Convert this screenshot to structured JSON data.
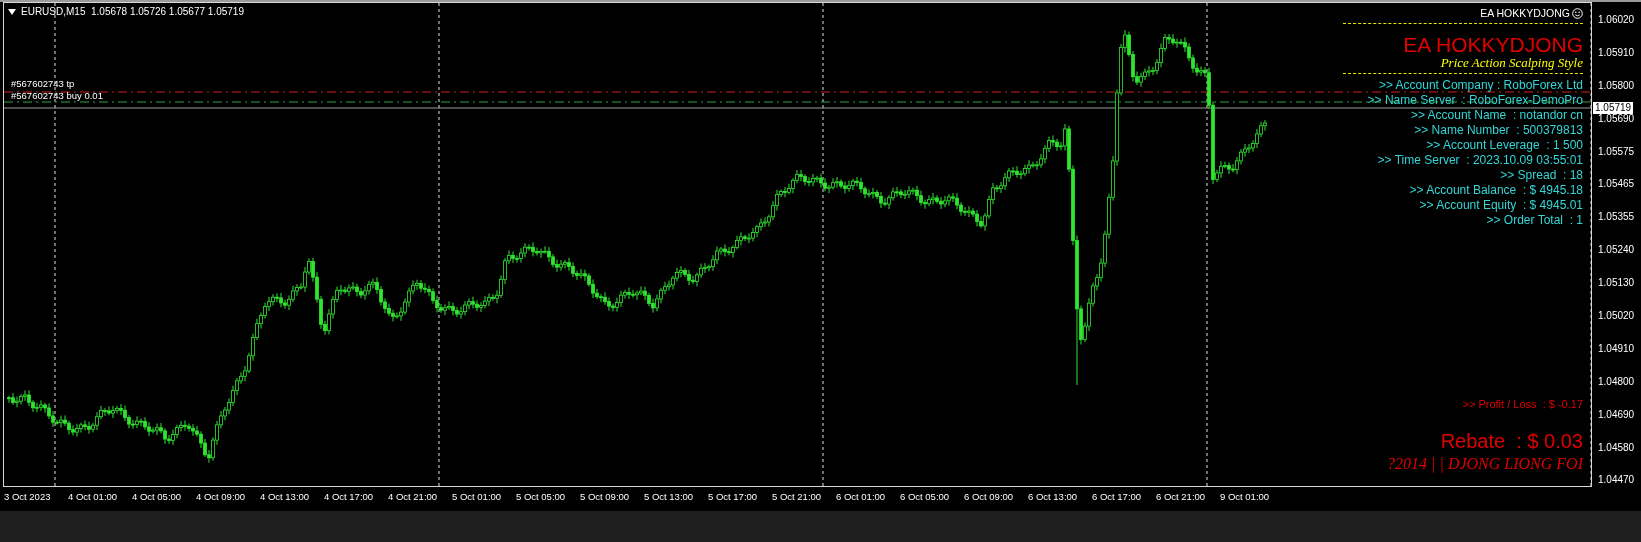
{
  "chart": {
    "symbol_info": "EURUSD,M15  1.05678 1.05726 1.05677 1.05719",
    "order_labels": [
      "#567602743 tp",
      "#567602743 buy 0.01"
    ],
    "current_price": "1.05719",
    "price_axis": [
      "1.06020",
      "1.05910",
      "1.05800",
      "1.05690",
      "1.05575",
      "1.05465",
      "1.05355",
      "1.05240",
      "1.05130",
      "1.05020",
      "1.04910",
      "1.04800",
      "1.04690",
      "1.04580",
      "1.04470"
    ],
    "time_axis": [
      "3 Oct 2023",
      "4 Oct 01:00",
      "4 Oct 05:00",
      "4 Oct 09:00",
      "4 Oct 13:00",
      "4 Oct 17:00",
      "4 Oct 21:00",
      "5 Oct 01:00",
      "5 Oct 05:00",
      "5 Oct 09:00",
      "5 Oct 13:00",
      "5 Oct 17:00",
      "5 Oct 21:00",
      "6 Oct 01:00",
      "6 Oct 05:00",
      "6 Oct 09:00",
      "6 Oct 13:00",
      "6 Oct 17:00",
      "6 Oct 21:00",
      "9 Oct 01:00"
    ]
  },
  "ea_panel": {
    "header": "EA HOKKYDJONG",
    "title": "EA HOKKYDJONG",
    "subtitle": "Price Action Scalping Style",
    "info": [
      ">> Account Company : RoboForex Ltd",
      ">> Name Server  : RoboForex-DemoPro",
      ">> Account Name  : notandor cn",
      ">> Name Number  : 500379813",
      ">> Account Leverage  : 1 500",
      ">> Time Server  : 2023.10.09 03:55:01",
      ">> Spread  : 18",
      ">> Account Balance  : $ 4945.18",
      ">> Account Equity  : $ 4945.01",
      ">> Order Total  : 1"
    ],
    "profit_loss": ">> Profit / Loss  : $ -0.17",
    "rebate": "Rebate  : $ 0.03",
    "footer": "?2014 | | DJONG LIONG FOI"
  }
}
